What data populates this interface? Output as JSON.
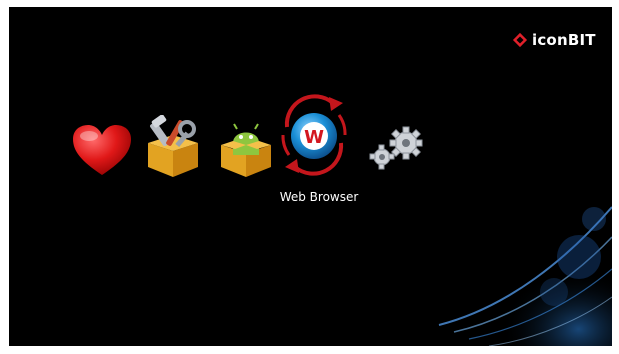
{
  "brand": {
    "name": "iconBIT"
  },
  "launcher": {
    "items": [
      {
        "icon": "heart-icon"
      },
      {
        "icon": "tools-box-icon"
      },
      {
        "icon": "android-box-icon"
      },
      {
        "icon": "web-browser-icon",
        "label": "Web Browser",
        "selected": true
      },
      {
        "icon": "settings-gears-icon"
      }
    ],
    "caption": "Web Browser"
  },
  "colors": {
    "background": "#000000",
    "accent": "#1a8fd6",
    "selection_ring": "#d11d1d"
  }
}
